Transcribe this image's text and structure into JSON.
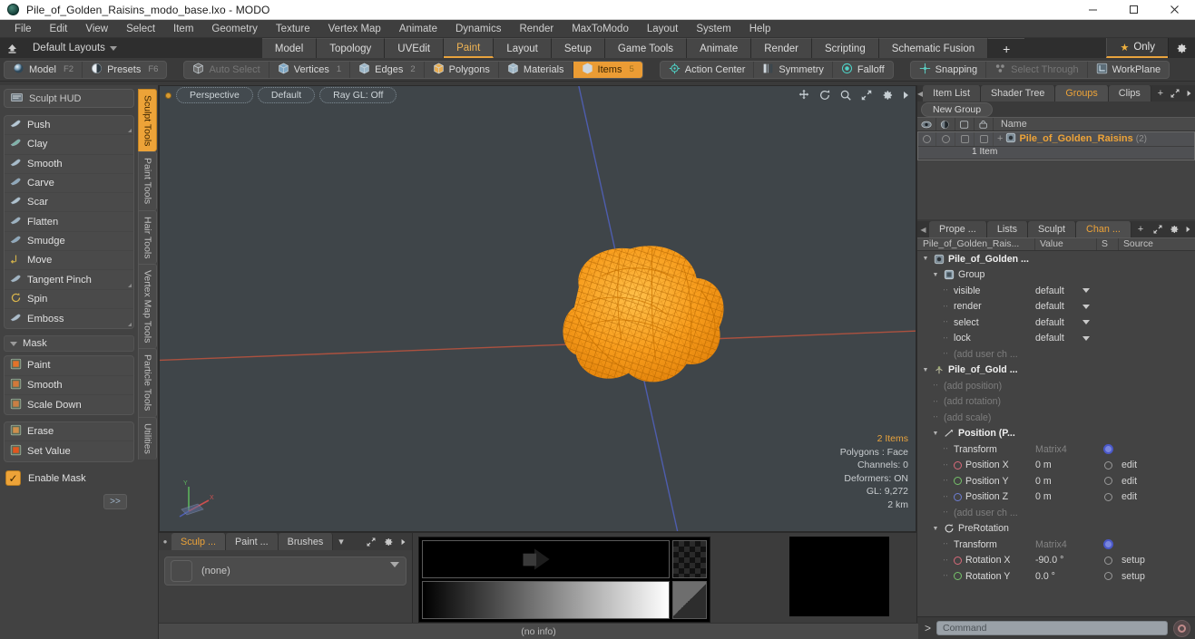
{
  "window": {
    "title": "Pile_of_Golden_Raisins_modo_base.lxo - MODO",
    "minimize": "–",
    "maximize": "❐",
    "close": "✕"
  },
  "menubar": [
    "File",
    "Edit",
    "View",
    "Select",
    "Item",
    "Geometry",
    "Texture",
    "Vertex Map",
    "Animate",
    "Dynamics",
    "Render",
    "MaxToModo",
    "Layout",
    "System",
    "Help"
  ],
  "layoutbar": {
    "layouts_label": "Default Layouts",
    "tabs": [
      {
        "label": "Model",
        "active": false
      },
      {
        "label": "Topology",
        "active": false
      },
      {
        "label": "UVEdit",
        "active": false
      },
      {
        "label": "Paint",
        "active": true
      },
      {
        "label": "Layout",
        "active": false
      },
      {
        "label": "Setup",
        "active": false
      },
      {
        "label": "Game Tools",
        "active": false
      },
      {
        "label": "Animate",
        "active": false
      },
      {
        "label": "Render",
        "active": false
      },
      {
        "label": "Scripting",
        "active": false
      },
      {
        "label": "Schematic Fusion",
        "active": false
      }
    ],
    "add_tab": "+",
    "only_label": "Only"
  },
  "modebar": {
    "group_left": [
      {
        "label": "Model",
        "hotkey": "F2",
        "state": "normal"
      },
      {
        "label": "Presets",
        "hotkey": "F6",
        "state": "normal"
      }
    ],
    "group_mid": [
      {
        "label": "Auto Select",
        "hotkey": "",
        "state": "dim"
      },
      {
        "label": "Vertices",
        "hotkey": "1",
        "state": "normal"
      },
      {
        "label": "Edges",
        "hotkey": "2",
        "state": "normal"
      },
      {
        "label": "Polygons",
        "hotkey": "",
        "state": "normal"
      },
      {
        "label": "Materials",
        "hotkey": "",
        "state": "normal"
      },
      {
        "label": "Items",
        "hotkey": "5",
        "state": "selected"
      }
    ],
    "group_right": [
      {
        "label": "Action Center",
        "hotkey": "",
        "state": "normal"
      },
      {
        "label": "Symmetry",
        "hotkey": "",
        "state": "normal"
      },
      {
        "label": "Falloff",
        "hotkey": "",
        "state": "normal"
      }
    ],
    "group_right2": [
      {
        "label": "Snapping",
        "hotkey": "",
        "state": "normal"
      },
      {
        "label": "Select Through",
        "hotkey": "",
        "state": "dim"
      },
      {
        "label": "WorkPlane",
        "hotkey": "",
        "state": "normal"
      }
    ]
  },
  "left_panel": {
    "hud_label": "Sculpt HUD",
    "sculpt_tools": [
      "Push",
      "Clay",
      "Smooth",
      "Carve",
      "Scar",
      "Flatten",
      "Smudge",
      "Move",
      "Tangent Pinch",
      "Spin",
      "Emboss"
    ],
    "mask_header": "Mask",
    "mask_tools": [
      "Paint",
      "Smooth",
      "Scale Down"
    ],
    "mask_tools2": [
      "Erase",
      "Set Value"
    ],
    "enable_mask": "Enable Mask",
    "expand_label": ">>",
    "vertical_tabs": [
      {
        "label": "Sculpt Tools",
        "active": true
      },
      {
        "label": "Paint Tools",
        "active": false
      },
      {
        "label": "Hair Tools",
        "active": false
      },
      {
        "label": "Vertex Map Tools",
        "active": false
      },
      {
        "label": "Particle Tools",
        "active": false
      },
      {
        "label": "Utilities",
        "active": false
      }
    ]
  },
  "viewport": {
    "pills": [
      "Perspective",
      "Default",
      "Ray GL: Off"
    ],
    "info": [
      {
        "text": "2 Items",
        "highlight": true
      },
      {
        "text": "Polygons : Face",
        "highlight": false
      },
      {
        "text": "Channels: 0",
        "highlight": false
      },
      {
        "text": "Deformers: ON",
        "highlight": false
      },
      {
        "text": "GL: 9,272",
        "highlight": false
      },
      {
        "text": "2 km",
        "highlight": false
      }
    ],
    "model_color": "#f59b1e",
    "bg_color": "#3f4549",
    "axis_x_color": "#b2523f",
    "axis_z_color": "#4f5fb4"
  },
  "bottom_panel": {
    "tabs": [
      {
        "label": "Sculp ...",
        "active": true
      },
      {
        "label": "Paint ...",
        "active": false
      },
      {
        "label": "Brushes",
        "active": false
      }
    ],
    "preset_value": "(none)",
    "status": "(no info)"
  },
  "right_panel": {
    "top_tabs": [
      {
        "label": "Item List",
        "active": false
      },
      {
        "label": "Shader Tree",
        "active": false
      },
      {
        "label": "Groups",
        "active": true
      },
      {
        "label": "Clips",
        "active": false
      }
    ],
    "new_group_label": "New Group",
    "grid_name_header": "Name",
    "group_item": {
      "name": "Pile_of_Golden_Raisins",
      "count": "(2)",
      "sub": "1 Item"
    },
    "bottom_tabs": [
      {
        "label": "Prope ...",
        "active": false
      },
      {
        "label": "Lists",
        "active": false
      },
      {
        "label": "Sculpt",
        "active": false
      },
      {
        "label": "Chan ...",
        "active": true
      }
    ],
    "channel_headers": [
      "Pile_of_Golden_Rais...",
      "Value",
      "S",
      "Source"
    ],
    "channels": [
      {
        "indent": 0,
        "twisty": "down",
        "icon": "mesh",
        "name": "Pile_of_Golden ...",
        "value": "",
        "s": "",
        "source": "",
        "style": "bold"
      },
      {
        "indent": 1,
        "twisty": "down",
        "icon": "group",
        "name": "Group",
        "value": "",
        "s": "",
        "source": "",
        "style": "normal"
      },
      {
        "indent": 2,
        "twisty": "dash",
        "icon": "",
        "name": "visible",
        "value": "default",
        "s": "",
        "source": "",
        "style": "normal",
        "dropdown": true
      },
      {
        "indent": 2,
        "twisty": "dash",
        "icon": "",
        "name": "render",
        "value": "default",
        "s": "",
        "source": "",
        "style": "normal",
        "dropdown": true
      },
      {
        "indent": 2,
        "twisty": "dash",
        "icon": "",
        "name": "select",
        "value": "default",
        "s": "",
        "source": "",
        "style": "normal",
        "dropdown": true
      },
      {
        "indent": 2,
        "twisty": "dash",
        "icon": "",
        "name": "lock",
        "value": "default",
        "s": "",
        "source": "",
        "style": "normal",
        "dropdown": true
      },
      {
        "indent": 2,
        "twisty": "dash",
        "icon": "",
        "name": "(add user ch ...",
        "value": "",
        "s": "",
        "source": "",
        "style": "dim"
      },
      {
        "indent": 0,
        "twisty": "down",
        "icon": "locator",
        "name": "Pile_of_Gold ...",
        "value": "",
        "s": "",
        "source": "",
        "style": "bold"
      },
      {
        "indent": 1,
        "twisty": "dash",
        "icon": "",
        "name": "(add position)",
        "value": "",
        "s": "",
        "source": "",
        "style": "dim"
      },
      {
        "indent": 1,
        "twisty": "dash",
        "icon": "",
        "name": "(add rotation)",
        "value": "",
        "s": "",
        "source": "",
        "style": "dim"
      },
      {
        "indent": 1,
        "twisty": "dash",
        "icon": "",
        "name": "(add scale)",
        "value": "",
        "s": "",
        "source": "",
        "style": "dim"
      },
      {
        "indent": 1,
        "twisty": "down",
        "icon": "position",
        "name": "Position (P...",
        "value": "",
        "s": "",
        "source": "",
        "style": "bold"
      },
      {
        "indent": 2,
        "twisty": "dash",
        "icon": "",
        "name": "Transform",
        "value": "Matrix4",
        "s": "bluedot",
        "source": "",
        "style": "greyval"
      },
      {
        "indent": 2,
        "twisty": "dash",
        "icon": "circ-r",
        "name": "Position X",
        "value": "0 m",
        "s": "circle",
        "source": "edit",
        "style": "normal"
      },
      {
        "indent": 2,
        "twisty": "dash",
        "icon": "circ-g",
        "name": "Position Y",
        "value": "0 m",
        "s": "circle",
        "source": "edit",
        "style": "normal"
      },
      {
        "indent": 2,
        "twisty": "dash",
        "icon": "circ-b",
        "name": "Position Z",
        "value": "0 m",
        "s": "circle",
        "source": "edit",
        "style": "normal"
      },
      {
        "indent": 2,
        "twisty": "dash",
        "icon": "",
        "name": "(add user ch ...",
        "value": "",
        "s": "",
        "source": "",
        "style": "dim"
      },
      {
        "indent": 1,
        "twisty": "down",
        "icon": "prerot",
        "name": "PreRotation",
        "value": "",
        "s": "",
        "source": "",
        "style": "normal"
      },
      {
        "indent": 2,
        "twisty": "dash",
        "icon": "",
        "name": "Transform",
        "value": "Matrix4",
        "s": "bluedot",
        "source": "",
        "style": "greyval"
      },
      {
        "indent": 2,
        "twisty": "dash",
        "icon": "circ-r",
        "name": "Rotation X",
        "value": "-90.0 °",
        "s": "circle",
        "source": "setup",
        "style": "normal"
      },
      {
        "indent": 2,
        "twisty": "dash",
        "icon": "circ-g",
        "name": "Rotation Y",
        "value": "0.0 °",
        "s": "circle",
        "source": "setup",
        "style": "normal"
      }
    ],
    "command_placeholder": "Command",
    "command_prefix": ">"
  }
}
